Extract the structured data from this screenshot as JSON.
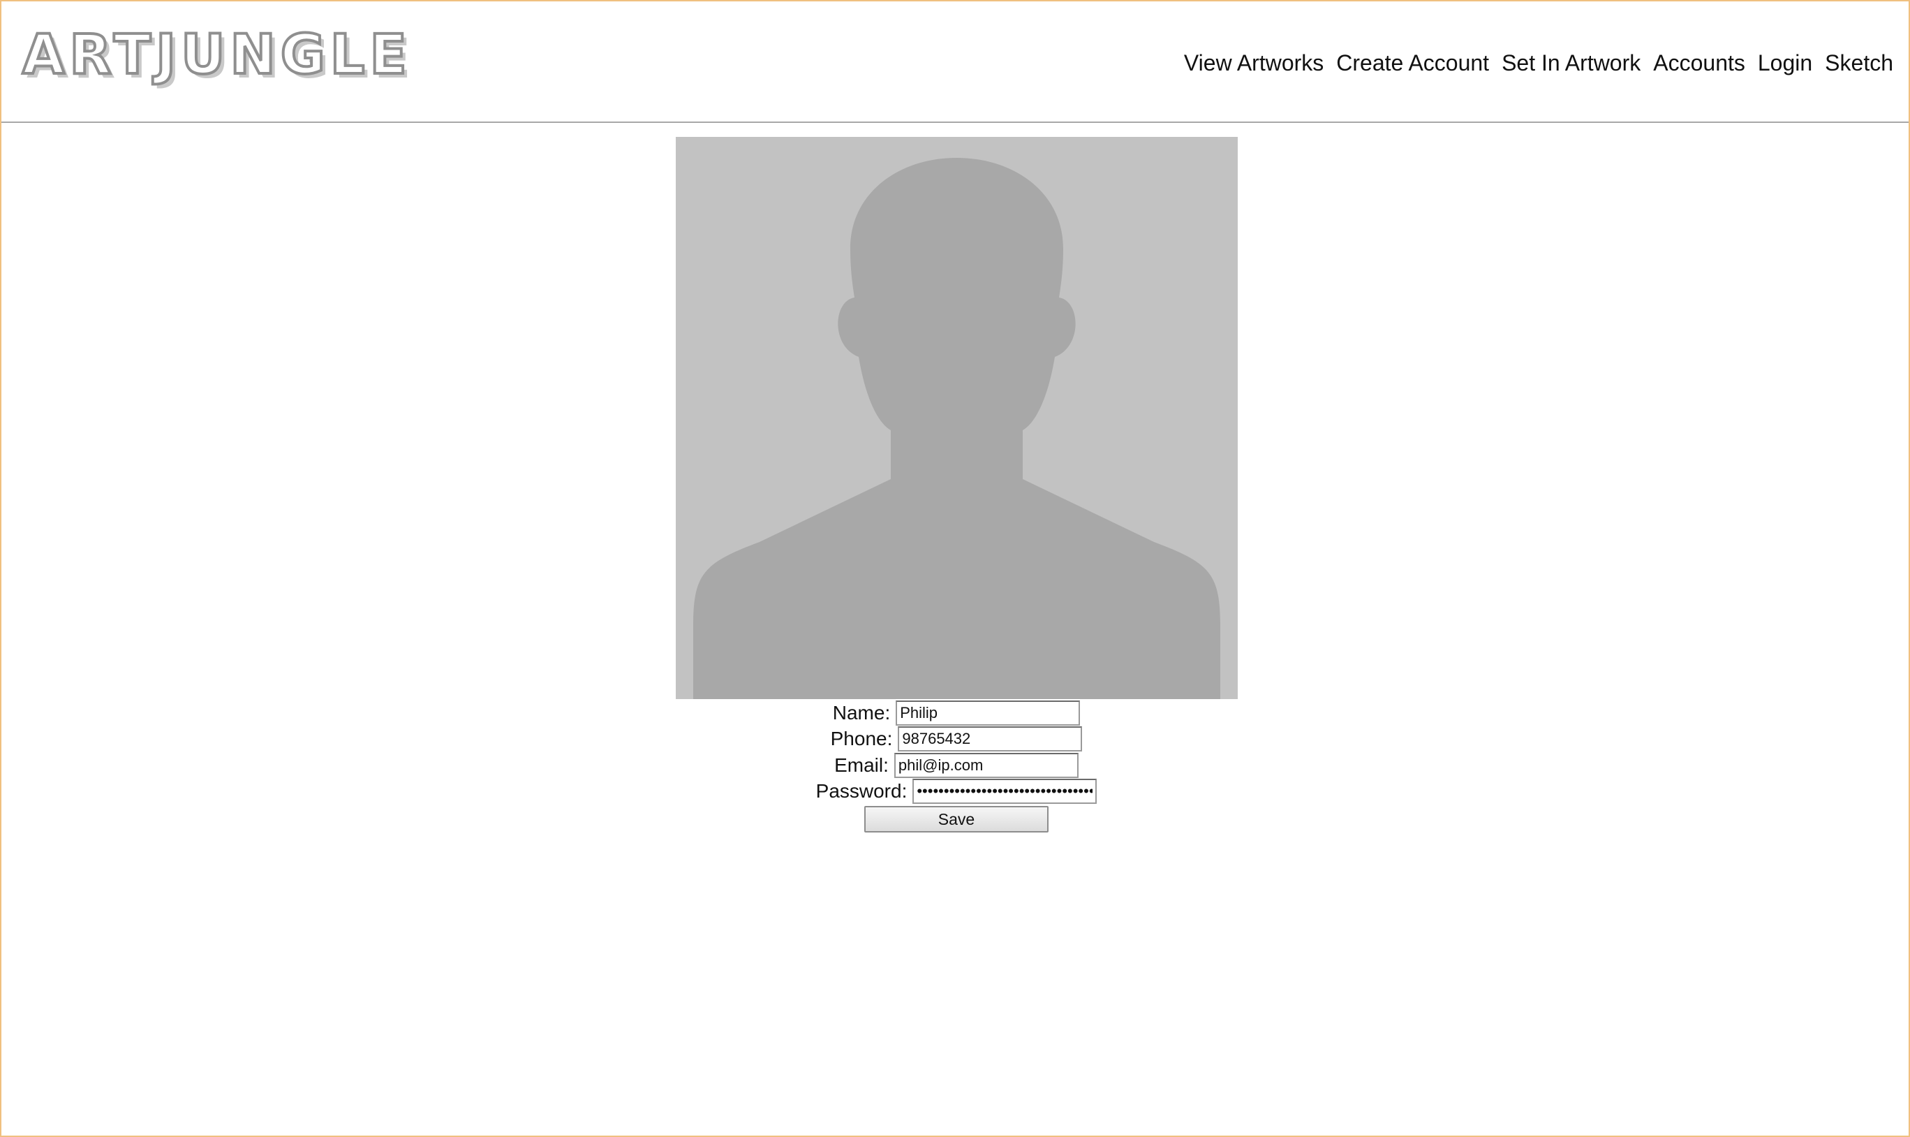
{
  "brand": {
    "logo_text": "ARTJUNGLE"
  },
  "nav": {
    "items": [
      {
        "label": "View Artworks"
      },
      {
        "label": "Create Account"
      },
      {
        "label": "Set In Artwork"
      },
      {
        "label": "Accounts"
      },
      {
        "label": "Login"
      },
      {
        "label": "Sketch"
      }
    ]
  },
  "profile": {
    "avatar_icon": "person-silhouette-icon",
    "avatar_bg_color": "#c2c2c2",
    "avatar_fg_color": "#a8a8a8"
  },
  "form": {
    "name_label": "Name:",
    "name_value": "Philip",
    "phone_label": "Phone:",
    "phone_value": "98765432",
    "email_label": "Email:",
    "email_value": "phil@ip.com",
    "password_label": "Password:",
    "password_value": "••••••••••••••••••••••••••••••••••",
    "save_label": "Save"
  },
  "colors": {
    "frame_border": "#f0c080",
    "header_divider": "#a8a8a8"
  }
}
